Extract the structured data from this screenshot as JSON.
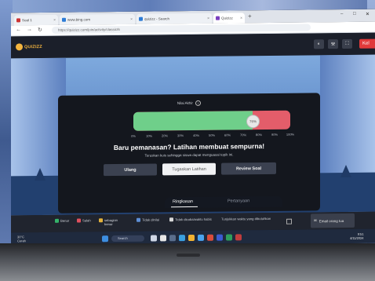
{
  "browser": {
    "tabs": [
      {
        "label": "Soal 1"
      },
      {
        "label": "www.bing.com"
      },
      {
        "label": "quizizz - Search"
      },
      {
        "label": "Quizizz"
      }
    ],
    "url": "https://quizizz.com/join/activity/classic/6"
  },
  "app": {
    "logo": "QUIZIZZ",
    "exit_label": "Kel"
  },
  "result": {
    "accuracy_label": "Nilai Akhir",
    "accuracy_value": "76%",
    "accuracy_fraction": 0.76,
    "ticks": [
      "0%",
      "10%",
      "20%",
      "30%",
      "40%",
      "50%",
      "60%",
      "70%",
      "80%",
      "90%",
      "100%"
    ],
    "headline": "Baru pemanasan? Latihan membuat sempurna!",
    "subtitle": "Teruskan kuis sehingga siswa dapat menguasai topik ini.",
    "buttons": {
      "retry": "Ulang",
      "assign": "Tugaskan Latihan",
      "review": "Review Soal"
    }
  },
  "bottom_tabs": {
    "summary": "Ringkasan",
    "questions": "Pertanyaan"
  },
  "legend": [
    {
      "label": "Benar",
      "color": "#35b36a"
    },
    {
      "label": "Salah",
      "color": "#e0505e"
    },
    {
      "label": "sebagian benar",
      "color": "#e3b23c"
    },
    {
      "label": "Tidak dinilai",
      "color": "#5e8fd6"
    },
    {
      "label": "Tidak dicoba/waktu habis",
      "color": "#d9d9d9"
    }
  ],
  "show_time_label": "Tunjukkan waktu yang dibutuhkan",
  "email_label": "Email orang tua",
  "taskbar": {
    "temp": "30°C",
    "weather": "Cerah",
    "search": "Search",
    "time": "9:51",
    "date": "4/11/2024"
  }
}
